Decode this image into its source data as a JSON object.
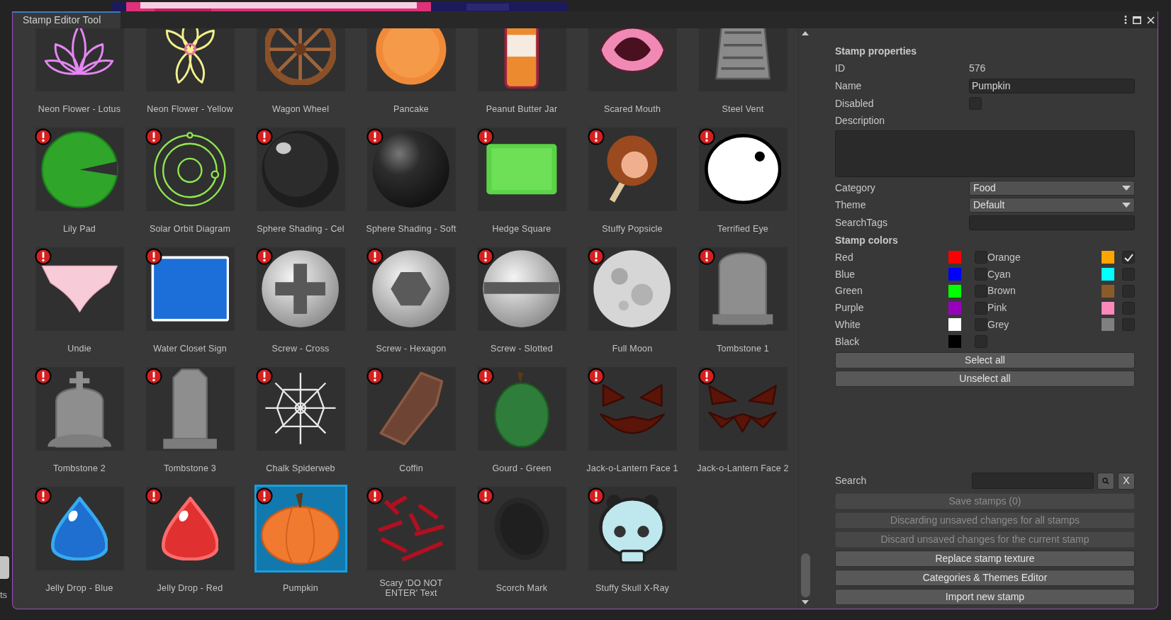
{
  "window": {
    "title": "Stamp Editor Tool"
  },
  "stamps": [
    {
      "label": "Neon Flower - Lotus",
      "warning": false,
      "selected": false
    },
    {
      "label": "Neon Flower - Yellow",
      "warning": false,
      "selected": false
    },
    {
      "label": "Wagon Wheel",
      "warning": false,
      "selected": false
    },
    {
      "label": "Pancake",
      "warning": false,
      "selected": false
    },
    {
      "label": "Peanut Butter Jar",
      "warning": false,
      "selected": false
    },
    {
      "label": "Scared Mouth",
      "warning": false,
      "selected": false
    },
    {
      "label": "Steel Vent",
      "warning": false,
      "selected": false
    },
    {
      "label": "Lily Pad",
      "warning": true,
      "selected": false
    },
    {
      "label": "Solar Orbit Diagram",
      "warning": true,
      "selected": false
    },
    {
      "label": "Sphere Shading - Cel",
      "warning": true,
      "selected": false
    },
    {
      "label": "Sphere Shading - Soft",
      "warning": true,
      "selected": false
    },
    {
      "label": "Hedge Square",
      "warning": true,
      "selected": false
    },
    {
      "label": "Stuffy Popsicle",
      "warning": true,
      "selected": false
    },
    {
      "label": "Terrified Eye",
      "warning": true,
      "selected": false
    },
    {
      "label": "Undie",
      "warning": true,
      "selected": false
    },
    {
      "label": "Water Closet Sign",
      "warning": true,
      "selected": false
    },
    {
      "label": "Screw - Cross",
      "warning": true,
      "selected": false
    },
    {
      "label": "Screw - Hexagon",
      "warning": true,
      "selected": false
    },
    {
      "label": "Screw - Slotted",
      "warning": true,
      "selected": false
    },
    {
      "label": "Full Moon",
      "warning": true,
      "selected": false
    },
    {
      "label": "Tombstone 1",
      "warning": true,
      "selected": false
    },
    {
      "label": "Tombstone 2",
      "warning": true,
      "selected": false
    },
    {
      "label": "Tombstone 3",
      "warning": true,
      "selected": false
    },
    {
      "label": "Chalk Spiderweb",
      "warning": true,
      "selected": false
    },
    {
      "label": "Coffin",
      "warning": true,
      "selected": false
    },
    {
      "label": "Gourd - Green",
      "warning": true,
      "selected": false
    },
    {
      "label": "Jack-o-Lantern Face 1",
      "warning": true,
      "selected": false
    },
    {
      "label": "Jack-o-Lantern Face 2",
      "warning": true,
      "selected": false
    },
    {
      "label": "Jelly Drop - Blue",
      "warning": true,
      "selected": false
    },
    {
      "label": "Jelly Drop - Red",
      "warning": true,
      "selected": false
    },
    {
      "label": "Pumpkin",
      "warning": true,
      "selected": true
    },
    {
      "label": "Scary 'DO NOT ENTER' Text",
      "warning": true,
      "selected": false
    },
    {
      "label": "Scorch Mark",
      "warning": true,
      "selected": false
    },
    {
      "label": "Stuffy Skull X-Ray",
      "warning": true,
      "selected": false
    }
  ],
  "properties": {
    "heading": "Stamp properties",
    "fields": [
      {
        "kind": "text",
        "label": "ID",
        "value": "576"
      },
      {
        "kind": "input",
        "label": "Name",
        "value": "Pumpkin"
      },
      {
        "kind": "checkbox",
        "label": "Disabled",
        "checked": false
      },
      {
        "kind": "textarea",
        "label": "Description"
      },
      {
        "kind": "select",
        "label": "Category",
        "value": "Food"
      },
      {
        "kind": "select",
        "label": "Theme",
        "value": "Default"
      },
      {
        "kind": "input",
        "label": "SearchTags"
      }
    ]
  },
  "stamp_colors": {
    "heading": "Stamp colors",
    "items": [
      {
        "name": "Red",
        "color": "#ff0000",
        "checked": false
      },
      {
        "name": "Orange",
        "color": "#ffa500",
        "checked": true
      },
      {
        "name": "Blue",
        "color": "#0000ff",
        "checked": false
      },
      {
        "name": "Cyan",
        "color": "#00ffff",
        "checked": false
      },
      {
        "name": "Green",
        "color": "#00ff00",
        "checked": false
      },
      {
        "name": "Brown",
        "color": "#8b5a2b",
        "checked": false
      },
      {
        "name": "Purple",
        "color": "#9900bb",
        "checked": false
      },
      {
        "name": "Pink",
        "color": "#ff88bb",
        "checked": false
      },
      {
        "name": "White",
        "color": "#ffffff",
        "checked": false
      },
      {
        "name": "Grey",
        "color": "#808080",
        "checked": false
      },
      {
        "name": "Black",
        "color": "#000000",
        "checked": false
      }
    ]
  },
  "select_buttons": [
    {
      "label": "Select all",
      "disabled": false
    },
    {
      "label": "Unselect all",
      "disabled": false
    }
  ],
  "search": {
    "label": "Search",
    "clear": "X"
  },
  "actions": [
    {
      "label": "Save stamps (0)",
      "disabled": true
    },
    {
      "label": "Discarding unsaved changes for all stamps",
      "disabled": true
    },
    {
      "label": "Discard unsaved changes for the current stamp",
      "disabled": true
    },
    {
      "label": "Replace stamp texture",
      "disabled": false
    },
    {
      "label": "Categories & Themes Editor",
      "disabled": false
    },
    {
      "label": "Import new stamp",
      "disabled": false
    }
  ],
  "background_fragment": "ts"
}
